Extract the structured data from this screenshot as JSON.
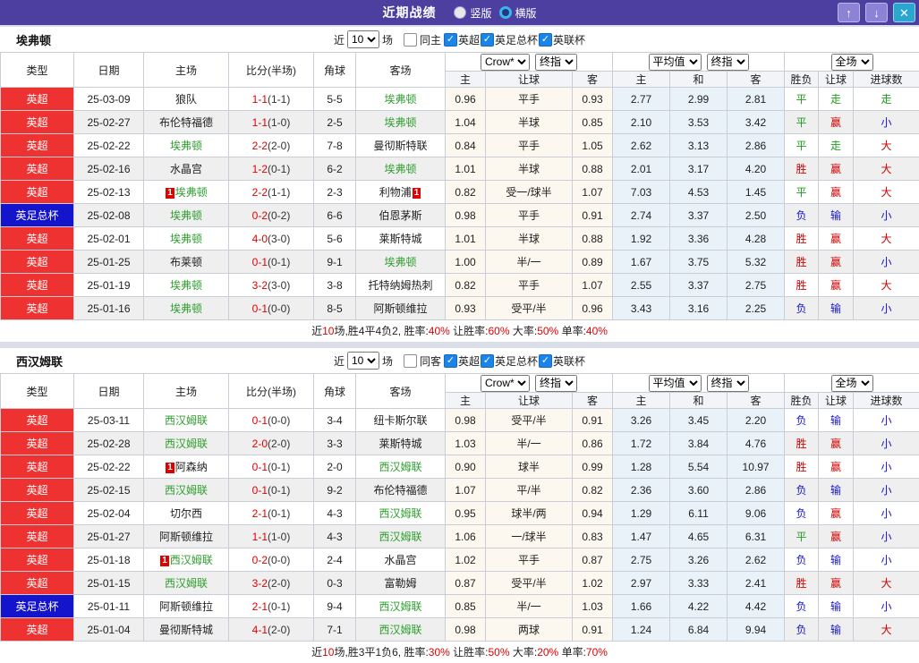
{
  "topbar": {
    "title": "近期战绩",
    "radio_vertical": "竖版",
    "radio_horizontal": "横版",
    "up_icon": "↑",
    "down_icon": "↓",
    "close_icon": "✕"
  },
  "colors": {
    "titlebar_bg": "#4c3f9f",
    "league": {
      "英超": "#ee3232",
      "英足总杯": "#1414cc",
      "英联杯": "#1414cc"
    },
    "outcome": {
      "胜": "#d40000",
      "赢": "#d40000",
      "大": "#d40000",
      "平": "#1e9e1e",
      "走": "#1e9e1e",
      "负": "#1515cc",
      "输": "#1515cc",
      "小": "#1515cc"
    },
    "team_focus": "#2f9e2f",
    "score_red": "#e00000"
  },
  "table_header": {
    "left": [
      "类型",
      "日期",
      "主场",
      "比分(半场)",
      "角球",
      "客场"
    ],
    "dropdown_groups": [
      [
        "Crow*",
        "终指"
      ],
      [
        "平均值",
        "终指"
      ],
      [
        "全场"
      ]
    ],
    "sub": [
      "主",
      "让球",
      "客",
      "主",
      "和",
      "客",
      "胜负",
      "让球",
      "进球数"
    ]
  },
  "sections": [
    {
      "team": "埃弗顿",
      "filters": {
        "near": "近",
        "count": "10",
        "games": "场",
        "same_label": "同主",
        "same_checked": false,
        "leagues": [
          {
            "label": "英超",
            "checked": true
          },
          {
            "label": "英足总杯",
            "checked": true
          },
          {
            "label": "英联杯",
            "checked": true
          }
        ]
      },
      "rows": [
        {
          "league": "英超",
          "date": "25-03-09",
          "home": "狼队",
          "hf": false,
          "hc": 0,
          "score": "1-1",
          "half": "(1-1)",
          "corner": "5-5",
          "away": "埃弗顿",
          "af": true,
          "ac": 0,
          "odds": [
            "0.96",
            "平手",
            "0.93"
          ],
          "avg": [
            "2.77",
            "2.99",
            "2.81"
          ],
          "res": [
            "平",
            "走",
            "走"
          ]
        },
        {
          "league": "英超",
          "date": "25-02-27",
          "home": "布伦特福德",
          "hf": false,
          "hc": 0,
          "score": "1-1",
          "half": "(1-0)",
          "corner": "2-5",
          "away": "埃弗顿",
          "af": true,
          "ac": 0,
          "odds": [
            "1.04",
            "半球",
            "0.85"
          ],
          "avg": [
            "2.10",
            "3.53",
            "3.42"
          ],
          "res": [
            "平",
            "赢",
            "小"
          ]
        },
        {
          "league": "英超",
          "date": "25-02-22",
          "home": "埃弗顿",
          "hf": true,
          "hc": 0,
          "score": "2-2",
          "half": "(2-0)",
          "corner": "7-8",
          "away": "曼彻斯特联",
          "af": false,
          "ac": 0,
          "odds": [
            "0.84",
            "平手",
            "1.05"
          ],
          "avg": [
            "2.62",
            "3.13",
            "2.86"
          ],
          "res": [
            "平",
            "走",
            "大"
          ]
        },
        {
          "league": "英超",
          "date": "25-02-16",
          "home": "水晶宫",
          "hf": false,
          "hc": 0,
          "score": "1-2",
          "half": "(0-1)",
          "corner": "6-2",
          "away": "埃弗顿",
          "af": true,
          "ac": 0,
          "odds": [
            "1.01",
            "半球",
            "0.88"
          ],
          "avg": [
            "2.01",
            "3.17",
            "4.20"
          ],
          "res": [
            "胜",
            "赢",
            "大"
          ]
        },
        {
          "league": "英超",
          "date": "25-02-13",
          "home": "埃弗顿",
          "hf": true,
          "hc": 1,
          "score": "2-2",
          "half": "(1-1)",
          "corner": "2-3",
          "away": "利物浦",
          "af": false,
          "ac": 1,
          "odds": [
            "0.82",
            "受一/球半",
            "1.07"
          ],
          "avg": [
            "7.03",
            "4.53",
            "1.45"
          ],
          "res": [
            "平",
            "赢",
            "大"
          ]
        },
        {
          "league": "英足总杯",
          "date": "25-02-08",
          "home": "埃弗顿",
          "hf": true,
          "hc": 0,
          "score": "0-2",
          "half": "(0-2)",
          "corner": "6-6",
          "away": "伯恩茅斯",
          "af": false,
          "ac": 0,
          "odds": [
            "0.98",
            "平手",
            "0.91"
          ],
          "avg": [
            "2.74",
            "3.37",
            "2.50"
          ],
          "res": [
            "负",
            "输",
            "小"
          ]
        },
        {
          "league": "英超",
          "date": "25-02-01",
          "home": "埃弗顿",
          "hf": true,
          "hc": 0,
          "score": "4-0",
          "half": "(3-0)",
          "corner": "5-6",
          "away": "莱斯特城",
          "af": false,
          "ac": 0,
          "odds": [
            "1.01",
            "半球",
            "0.88"
          ],
          "avg": [
            "1.92",
            "3.36",
            "4.28"
          ],
          "res": [
            "胜",
            "赢",
            "大"
          ]
        },
        {
          "league": "英超",
          "date": "25-01-25",
          "home": "布莱顿",
          "hf": false,
          "hc": 0,
          "score": "0-1",
          "half": "(0-1)",
          "corner": "9-1",
          "away": "埃弗顿",
          "af": true,
          "ac": 0,
          "odds": [
            "1.00",
            "半/一",
            "0.89"
          ],
          "avg": [
            "1.67",
            "3.75",
            "5.32"
          ],
          "res": [
            "胜",
            "赢",
            "小"
          ]
        },
        {
          "league": "英超",
          "date": "25-01-19",
          "home": "埃弗顿",
          "hf": true,
          "hc": 0,
          "score": "3-2",
          "half": "(3-0)",
          "corner": "3-8",
          "away": "托特纳姆热刺",
          "af": false,
          "ac": 0,
          "odds": [
            "0.82",
            "平手",
            "1.07"
          ],
          "avg": [
            "2.55",
            "3.37",
            "2.75"
          ],
          "res": [
            "胜",
            "赢",
            "大"
          ]
        },
        {
          "league": "英超",
          "date": "25-01-16",
          "home": "埃弗顿",
          "hf": true,
          "hc": 0,
          "score": "0-1",
          "half": "(0-0)",
          "corner": "8-5",
          "away": "阿斯顿维拉",
          "af": false,
          "ac": 0,
          "odds": [
            "0.93",
            "受平/半",
            "0.96"
          ],
          "avg": [
            "3.43",
            "3.16",
            "2.25"
          ],
          "res": [
            "负",
            "输",
            "小"
          ]
        }
      ],
      "summary": [
        {
          "t": "近",
          "red": false
        },
        {
          "t": "10",
          "red": true
        },
        {
          "t": "场,胜4平4负2, 胜率:",
          "red": false
        },
        {
          "t": "40%",
          "red": true
        },
        {
          "t": " 让胜率:",
          "red": false
        },
        {
          "t": "60%",
          "red": true
        },
        {
          "t": " 大率:",
          "red": false
        },
        {
          "t": "50%",
          "red": true
        },
        {
          "t": " 单率:",
          "red": false
        },
        {
          "t": "40%",
          "red": true
        }
      ]
    },
    {
      "team": "西汉姆联",
      "filters": {
        "near": "近",
        "count": "10",
        "games": "场",
        "same_label": "同客",
        "same_checked": false,
        "leagues": [
          {
            "label": "英超",
            "checked": true
          },
          {
            "label": "英足总杯",
            "checked": true
          },
          {
            "label": "英联杯",
            "checked": true
          }
        ]
      },
      "rows": [
        {
          "league": "英超",
          "date": "25-03-11",
          "home": "西汉姆联",
          "hf": true,
          "hc": 0,
          "score": "0-1",
          "half": "(0-0)",
          "corner": "3-4",
          "away": "纽卡斯尔联",
          "af": false,
          "ac": 0,
          "odds": [
            "0.98",
            "受平/半",
            "0.91"
          ],
          "avg": [
            "3.26",
            "3.45",
            "2.20"
          ],
          "res": [
            "负",
            "输",
            "小"
          ]
        },
        {
          "league": "英超",
          "date": "25-02-28",
          "home": "西汉姆联",
          "hf": true,
          "hc": 0,
          "score": "2-0",
          "half": "(2-0)",
          "corner": "3-3",
          "away": "莱斯特城",
          "af": false,
          "ac": 0,
          "odds": [
            "1.03",
            "半/一",
            "0.86"
          ],
          "avg": [
            "1.72",
            "3.84",
            "4.76"
          ],
          "res": [
            "胜",
            "赢",
            "小"
          ]
        },
        {
          "league": "英超",
          "date": "25-02-22",
          "home": "阿森纳",
          "hf": false,
          "hc": 1,
          "score": "0-1",
          "half": "(0-1)",
          "corner": "2-0",
          "away": "西汉姆联",
          "af": true,
          "ac": 0,
          "odds": [
            "0.90",
            "球半",
            "0.99"
          ],
          "avg": [
            "1.28",
            "5.54",
            "10.97"
          ],
          "res": [
            "胜",
            "赢",
            "小"
          ]
        },
        {
          "league": "英超",
          "date": "25-02-15",
          "home": "西汉姆联",
          "hf": true,
          "hc": 0,
          "score": "0-1",
          "half": "(0-1)",
          "corner": "9-2",
          "away": "布伦特福德",
          "af": false,
          "ac": 0,
          "odds": [
            "1.07",
            "平/半",
            "0.82"
          ],
          "avg": [
            "2.36",
            "3.60",
            "2.86"
          ],
          "res": [
            "负",
            "输",
            "小"
          ]
        },
        {
          "league": "英超",
          "date": "25-02-04",
          "home": "切尔西",
          "hf": false,
          "hc": 0,
          "score": "2-1",
          "half": "(0-1)",
          "corner": "4-3",
          "away": "西汉姆联",
          "af": true,
          "ac": 0,
          "odds": [
            "0.95",
            "球半/两",
            "0.94"
          ],
          "avg": [
            "1.29",
            "6.11",
            "9.06"
          ],
          "res": [
            "负",
            "赢",
            "小"
          ]
        },
        {
          "league": "英超",
          "date": "25-01-27",
          "home": "阿斯顿维拉",
          "hf": false,
          "hc": 0,
          "score": "1-1",
          "half": "(1-0)",
          "corner": "4-3",
          "away": "西汉姆联",
          "af": true,
          "ac": 0,
          "odds": [
            "1.06",
            "一/球半",
            "0.83"
          ],
          "avg": [
            "1.47",
            "4.65",
            "6.31"
          ],
          "res": [
            "平",
            "赢",
            "小"
          ]
        },
        {
          "league": "英超",
          "date": "25-01-18",
          "home": "西汉姆联",
          "hf": true,
          "hc": 1,
          "score": "0-2",
          "half": "(0-0)",
          "corner": "2-4",
          "away": "水晶宫",
          "af": false,
          "ac": 0,
          "odds": [
            "1.02",
            "平手",
            "0.87"
          ],
          "avg": [
            "2.75",
            "3.26",
            "2.62"
          ],
          "res": [
            "负",
            "输",
            "小"
          ]
        },
        {
          "league": "英超",
          "date": "25-01-15",
          "home": "西汉姆联",
          "hf": true,
          "hc": 0,
          "score": "3-2",
          "half": "(2-0)",
          "corner": "0-3",
          "away": "富勒姆",
          "af": false,
          "ac": 0,
          "odds": [
            "0.87",
            "受平/半",
            "1.02"
          ],
          "avg": [
            "2.97",
            "3.33",
            "2.41"
          ],
          "res": [
            "胜",
            "赢",
            "大"
          ]
        },
        {
          "league": "英足总杯",
          "date": "25-01-11",
          "home": "阿斯顿维拉",
          "hf": false,
          "hc": 0,
          "score": "2-1",
          "half": "(0-1)",
          "corner": "9-4",
          "away": "西汉姆联",
          "af": true,
          "ac": 0,
          "odds": [
            "0.85",
            "半/一",
            "1.03"
          ],
          "avg": [
            "1.66",
            "4.22",
            "4.42"
          ],
          "res": [
            "负",
            "输",
            "小"
          ]
        },
        {
          "league": "英超",
          "date": "25-01-04",
          "home": "曼彻斯特城",
          "hf": false,
          "hc": 0,
          "score": "4-1",
          "half": "(2-0)",
          "corner": "7-1",
          "away": "西汉姆联",
          "af": true,
          "ac": 0,
          "odds": [
            "0.98",
            "两球",
            "0.91"
          ],
          "avg": [
            "1.24",
            "6.84",
            "9.94"
          ],
          "res": [
            "负",
            "输",
            "大"
          ]
        }
      ],
      "summary": [
        {
          "t": "近",
          "red": false
        },
        {
          "t": "10",
          "red": true
        },
        {
          "t": "场,胜3平1负6, 胜率:",
          "red": false
        },
        {
          "t": "30%",
          "red": true
        },
        {
          "t": " 让胜率:",
          "red": false
        },
        {
          "t": "50%",
          "red": true
        },
        {
          "t": " 大率:",
          "red": false
        },
        {
          "t": "20%",
          "red": true
        },
        {
          "t": " 单率:",
          "red": false
        },
        {
          "t": "70%",
          "red": true
        }
      ]
    }
  ]
}
